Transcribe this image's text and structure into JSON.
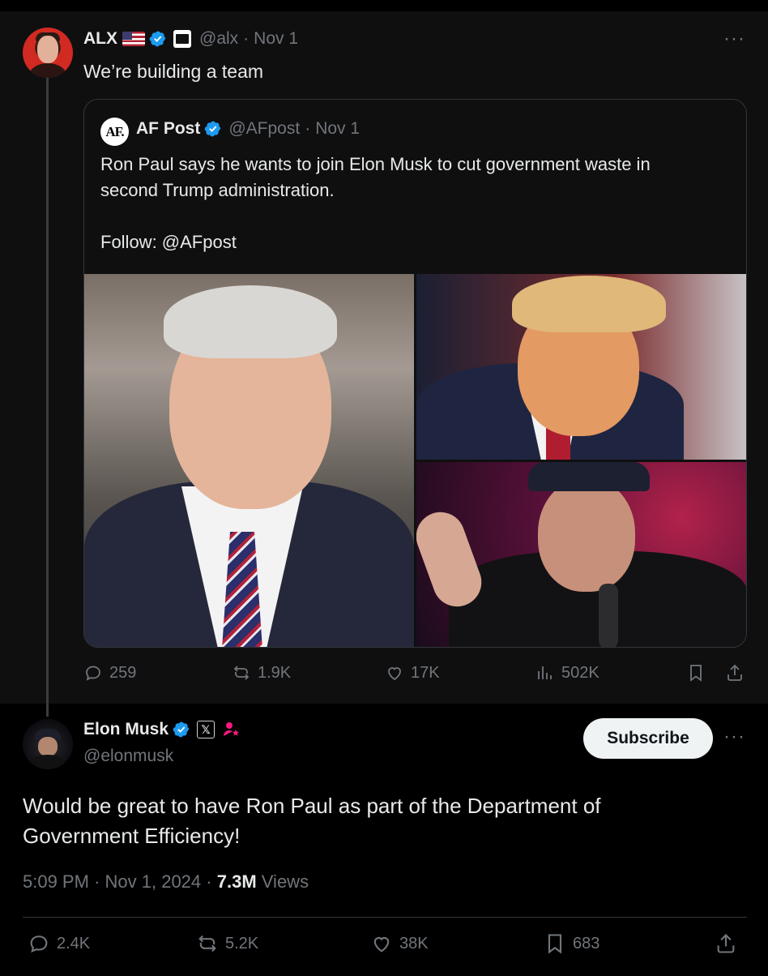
{
  "parent_tweet": {
    "author_name": "ALX",
    "handle": "@alx",
    "separator": "·",
    "date": "Nov 1",
    "text": "We’re building a team",
    "more": "···",
    "actions": {
      "replies": "259",
      "reposts": "1.9K",
      "likes": "17K",
      "views": "502K"
    }
  },
  "quoted_tweet": {
    "logo_text": "AF.",
    "author_name": "AF Post",
    "handle": "@AFpost",
    "separator": "·",
    "date": "Nov 1",
    "text_line1": "Ron Paul says he wants to join Elon Musk to cut government waste in",
    "text_line2": "second Trump administration.",
    "text_line3": "Follow: @AFpost"
  },
  "main_tweet": {
    "author_name": "Elon Musk",
    "handle": "@elonmusk",
    "subscribe_label": "Subscribe",
    "more": "···",
    "x_badge": "𝕏",
    "text_line1": "Would be great to have Ron Paul as part of the Department of",
    "text_line2": "Government Efficiency!",
    "time": "5:09 PM",
    "sep1": "·",
    "date": "Nov 1, 2024",
    "sep2": "·",
    "views_count": "7.3M",
    "views_label": "Views",
    "actions": {
      "replies": "2.4K",
      "reposts": "5.2K",
      "likes": "38K",
      "bookmarks": "683"
    }
  },
  "colors": {
    "verified_blue": "#1d9bf0",
    "muted": "#71767b",
    "text": "#e7e9ea",
    "affiliate_pink": "#f91880"
  },
  "icons": [
    "verified-icon",
    "us-flag-icon",
    "reply-icon",
    "repost-icon",
    "like-icon",
    "views-icon",
    "bookmark-icon",
    "share-icon",
    "x-badge-icon",
    "affiliate-icon"
  ]
}
